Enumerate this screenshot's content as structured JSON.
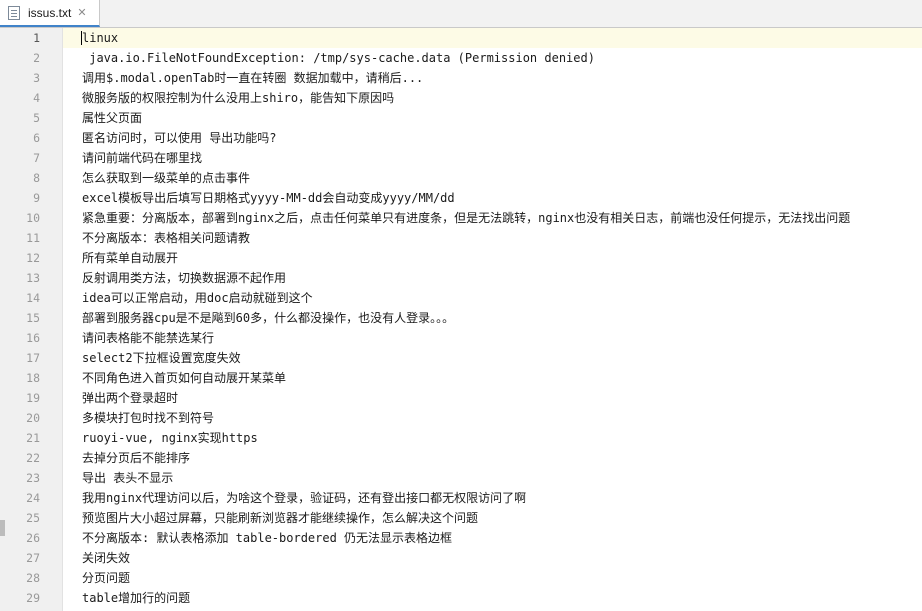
{
  "tab": {
    "icon": "text-file-icon",
    "title": "issus.txt",
    "close": "✕"
  },
  "colors": {
    "gutter_bg": "#f0f0f0",
    "current_line_bg": "#fdfbe6",
    "line_number": "#999999",
    "text": "#1a1a1a",
    "tab_active_accent": "#4083c9"
  },
  "editor": {
    "current_line": 1,
    "lines": [
      {
        "n": "1",
        "text": "linux"
      },
      {
        "n": "2",
        "text": " java.io.FileNotFoundException: /tmp/sys-cache.data (Permission denied)"
      },
      {
        "n": "3",
        "text": "调用$.modal.openTab时一直在转圈 数据加载中，请稍后..."
      },
      {
        "n": "4",
        "text": "微服务版的权限控制为什么没用上shiro，能告知下原因吗"
      },
      {
        "n": "5",
        "text": "属性父页面"
      },
      {
        "n": "6",
        "text": "匿名访问时，可以使用 导出功能吗?"
      },
      {
        "n": "7",
        "text": "请问前端代码在哪里找"
      },
      {
        "n": "8",
        "text": "怎么获取到一级菜单的点击事件"
      },
      {
        "n": "9",
        "text": "excel模板导出后填写日期格式yyyy-MM-dd会自动变成yyyy/MM/dd"
      },
      {
        "n": "10",
        "text": "紧急重要：分离版本，部署到nginx之后，点击任何菜单只有进度条，但是无法跳转，nginx也没有相关日志，前端也没任何提示，无法找出问题"
      },
      {
        "n": "11",
        "text": "不分离版本：表格相关问题请教"
      },
      {
        "n": "12",
        "text": "所有菜单自动展开"
      },
      {
        "n": "13",
        "text": "反射调用类方法，切换数据源不起作用"
      },
      {
        "n": "14",
        "text": "idea可以正常启动，用doc启动就碰到这个"
      },
      {
        "n": "15",
        "text": "部署到服务器cpu是不是飚到60多，什么都没操作，也没有人登录。。。"
      },
      {
        "n": "16",
        "text": "请问表格能不能禁选某行"
      },
      {
        "n": "17",
        "text": "select2下拉框设置宽度失效"
      },
      {
        "n": "18",
        "text": "不同角色进入首页如何自动展开某菜单"
      },
      {
        "n": "19",
        "text": "弹出两个登录超时"
      },
      {
        "n": "20",
        "text": "多模块打包时找不到符号"
      },
      {
        "n": "21",
        "text": "ruoyi-vue, nginx实现https"
      },
      {
        "n": "22",
        "text": "去掉分页后不能排序"
      },
      {
        "n": "23",
        "text": "导出 表头不显示"
      },
      {
        "n": "24",
        "text": "我用nginx代理访问以后，为啥这个登录，验证码，还有登出接口都无权限访问了啊"
      },
      {
        "n": "25",
        "text": "预览图片大小超过屏幕，只能刷新浏览器才能继续操作，怎么解决这个问题"
      },
      {
        "n": "26",
        "text": "不分离版本: 默认表格添加 table-bordered 仍无法显示表格边框"
      },
      {
        "n": "27",
        "text": "关闭失效"
      },
      {
        "n": "28",
        "text": "分页问题"
      },
      {
        "n": "29",
        "text": "table增加行的问题"
      }
    ]
  }
}
